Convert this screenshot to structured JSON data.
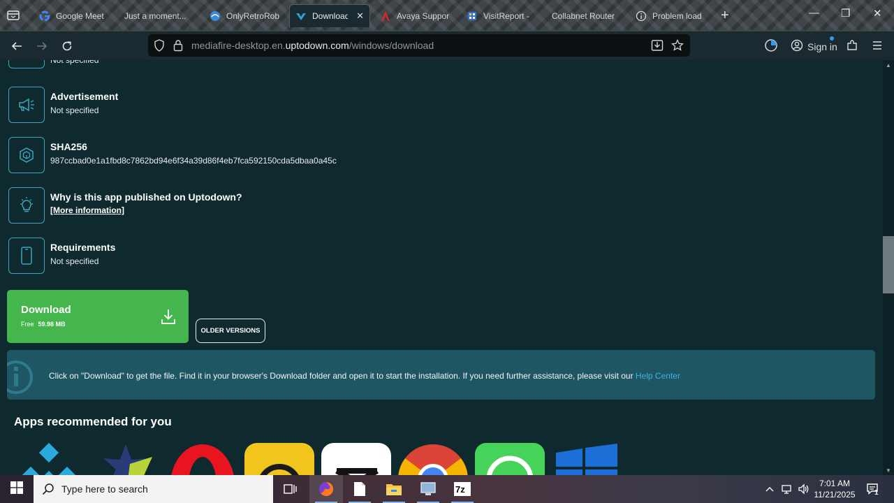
{
  "browser": {
    "tabs": [
      {
        "label": "Google Meet",
        "icon": "google-icon"
      },
      {
        "label": "Just a moment...",
        "icon": "blank-icon"
      },
      {
        "label": "OnlyRetroRob",
        "icon": "retro-icon"
      },
      {
        "label": "Download M",
        "icon": "uptodown-icon",
        "active": true
      },
      {
        "label": "Avaya Suppor",
        "icon": "avaya-icon"
      },
      {
        "label": "VisitReport - ",
        "icon": "visitreport-icon"
      },
      {
        "label": "Collabnet Router",
        "icon": "blank-icon"
      },
      {
        "label": "Problem load",
        "icon": "info-icon"
      }
    ],
    "url_prefix": "mediafire-desktop.en.",
    "url_host": "uptodown.com",
    "url_path": "/windows/download",
    "sign_in": "Sign in"
  },
  "page": {
    "partial_row_value": "Not specified",
    "info_rows": [
      {
        "title": "Advertisement",
        "value": "Not specified",
        "icon": "megaphone-icon"
      },
      {
        "title": "SHA256",
        "value": "987ccbad0e1a1fbd8c7862bd94e6f34a39d86f4eb7fca592150cda5dbaa0a45c",
        "icon": "cube-icon"
      },
      {
        "title": "Why is this app published on Uptodown?",
        "link": "[More information]",
        "icon": "lightbulb-icon"
      },
      {
        "title": "Requirements",
        "value": "Not specified",
        "icon": "phone-icon"
      }
    ],
    "download": {
      "label": "Download",
      "free": "Free",
      "size": "59.98 MB"
    },
    "older_versions": "OLDER VERSIONS",
    "notice": {
      "text": "Click on \"Download\" to get the file. Find it in your browser's Download folder and open it to start the installation. If you need further assistance, please visit our ",
      "link": "Help Center"
    },
    "recommended_title": "Apps recommended for you",
    "recommended_apps": [
      "kodi-icon",
      "winamp-icon",
      "opera-icon",
      "tracker-icon",
      "capcut-icon",
      "chrome-icon",
      "whatsapp-icon",
      "windows-icon"
    ]
  },
  "taskbar": {
    "search_placeholder": "Type here to search",
    "time": "7:01 AM",
    "date": "11/21/2025",
    "notification_count": "1"
  },
  "colors": {
    "page_bg": "#0f2a2e",
    "accent_teal": "#3fa7bd",
    "download_green": "#45b54d",
    "notice_bg": "#1f5663",
    "link_blue": "#3ab5dc"
  }
}
